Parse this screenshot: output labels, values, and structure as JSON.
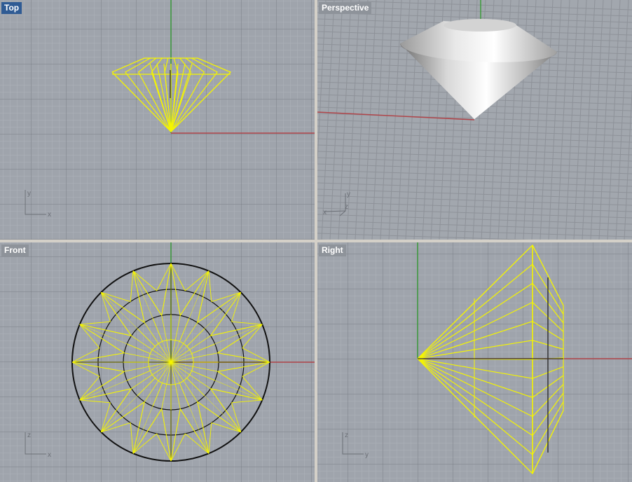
{
  "viewports": {
    "top": {
      "label": "Top",
      "axis_x": "x",
      "axis_y": "y"
    },
    "perspective": {
      "label": "Perspective",
      "axis_x": "x",
      "axis_y": "y",
      "axis_z": "z"
    },
    "front": {
      "label": "Front",
      "axis_x": "x",
      "axis_y": "z"
    },
    "right": {
      "label": "Right",
      "axis_x": "y",
      "axis_y": "z"
    }
  },
  "colors": {
    "x_axis": "#b0454a",
    "y_axis": "#3c9a3c",
    "wireframe": "#f5f500",
    "active_label": "#2f5b94",
    "grid_bg": "#9fa4ac"
  },
  "active_viewport": "top"
}
